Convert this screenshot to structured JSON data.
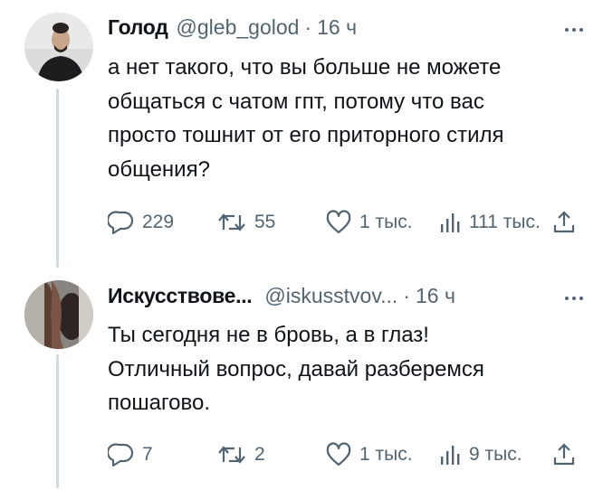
{
  "tweets": [
    {
      "author_name": "Голод",
      "handle": "@gleb_golod",
      "separator": "·",
      "time": "16 ч",
      "text_lines": [
        "а нет такого, что вы больше не можете",
        "общаться с чатом гпт, потому что вас",
        "просто тошнит от его приторного стиля",
        "общения?"
      ],
      "replies": "229",
      "reposts": "55",
      "likes": "1 тыс.",
      "views": "111 тыс."
    },
    {
      "author_name": "Искусствове...",
      "handle": "@iskusstvov...",
      "separator": "·",
      "time": "16 ч",
      "text_lines": [
        "Ты сегодня не в бровь, а в глаз!",
        "Отличный вопрос, давай разберемся",
        "пошагово."
      ],
      "replies": "7",
      "reposts": "2",
      "likes": "1 тыс.",
      "views": "9 тыс."
    }
  ],
  "icons": {
    "reply": "reply-icon",
    "repost": "repost-icon",
    "like": "heart-icon",
    "views": "views-chart-icon",
    "share": "share-icon",
    "more": "more-dots-icon"
  },
  "colors": {
    "text": "#0f1419",
    "secondary": "#536471",
    "thread_line": "#cfd9de"
  }
}
